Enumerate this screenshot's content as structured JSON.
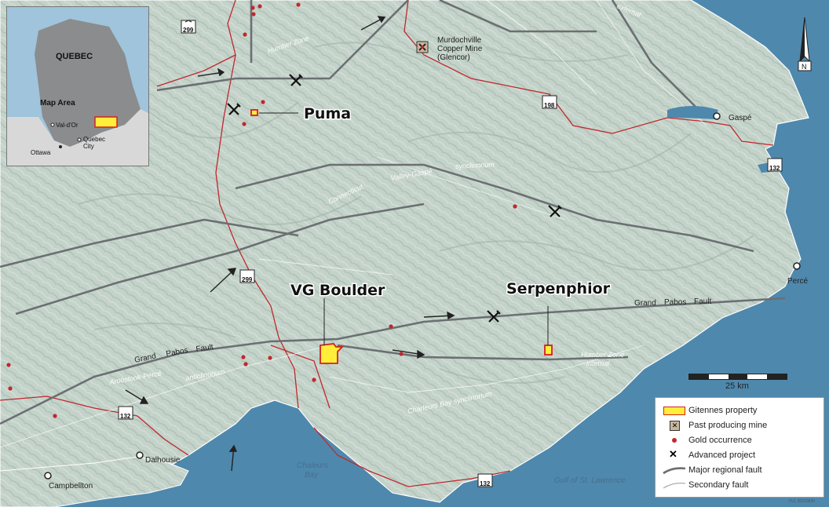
{
  "map": {
    "properties": [
      {
        "name": "Puma"
      },
      {
        "name": "VG Boulder"
      },
      {
        "name": "Serpenphior"
      }
    ],
    "places": {
      "murdochville": [
        "Murdochville",
        "Copper Mine",
        "(Glencor)"
      ],
      "gaspe": "Gaspé",
      "perce": "Percé",
      "dalhousie": "Dalhousie",
      "campbellton": "Campbellton"
    },
    "highways": [
      "299",
      "198",
      "132",
      "299",
      "132",
      "132"
    ],
    "geology": {
      "humber_zone": "Humber Zone",
      "external": "external",
      "connecticut": "Connecticut",
      "valley_gaspe": "Valley-Gaspé",
      "synclinorium": "synclinorium",
      "aroostook": "Aroostook-Percé",
      "anticlinorium": "anticlinorium",
      "chaleurs_syn": "Charleurs Bay synclinorium",
      "humber_internal_1": "Humber Zone",
      "humber_internal_2": "internal"
    },
    "faults": {
      "grand_pabos_east": [
        "Grand",
        "Pabos",
        "Fault"
      ],
      "grand_pabos_west": [
        "Grand",
        "Pabos",
        "Fault"
      ]
    },
    "water": {
      "chaleurs": [
        "Chaleurs",
        "Bay"
      ],
      "gulf": "Gulf of St. Lawrence"
    },
    "colors": {
      "land": "#c6d5cc",
      "water": "#4f88ad",
      "property_fill": "#ffee3a",
      "property_stroke": "#d42020",
      "gold": "#c0282d",
      "road": "#c0282d"
    }
  },
  "inset": {
    "province": "QUEBEC",
    "map_area": "Map Area",
    "cities": [
      "Val-d'Or",
      "Quebec",
      "City",
      "Ottawa"
    ]
  },
  "legend": {
    "items": [
      {
        "label": "Gitennes property",
        "icon": "property-icon"
      },
      {
        "label": "Past producing mine",
        "icon": "mine-icon"
      },
      {
        "label": "Gold occurrence",
        "icon": "gold-dot-icon"
      },
      {
        "label": "Advanced project",
        "icon": "crossed-hammers-icon"
      },
      {
        "label": "Major regional fault",
        "icon": "major-fault-icon"
      },
      {
        "label": "Secondary fault",
        "icon": "secondary-fault-icon"
      }
    ]
  },
  "scale": {
    "label": "25 km"
  },
  "north": {
    "label": "N"
  },
  "credit": "FUL 20210830"
}
